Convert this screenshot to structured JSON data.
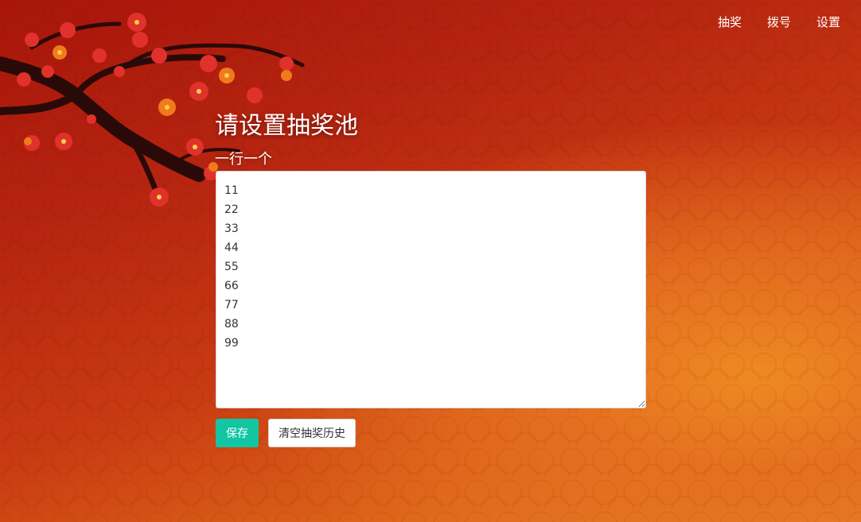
{
  "nav": {
    "items": [
      {
        "label": "抽奖"
      },
      {
        "label": "拨号"
      },
      {
        "label": "设置"
      }
    ]
  },
  "main": {
    "title": "请设置抽奖池",
    "subtitle": "一行一个",
    "pool_value": "11\n22\n33\n44\n55\n66\n77\n88\n99",
    "save_label": "保存",
    "clear_label": "清空抽奖历史"
  },
  "colors": {
    "accent": "#12c6a3",
    "background_top": "#a8150a",
    "background_bottom": "#e9862a",
    "blossom": "#e0322a",
    "branch": "#2a0a08"
  },
  "icons": {
    "decoration": "plum-blossom-branch"
  }
}
